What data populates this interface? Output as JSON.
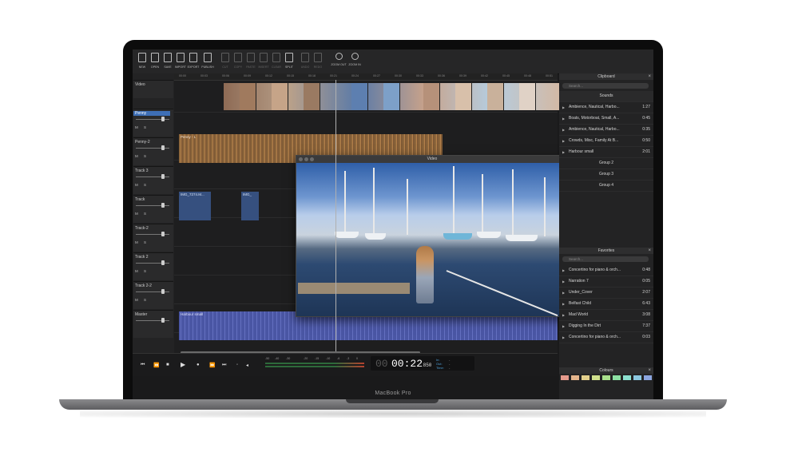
{
  "device": {
    "brand_label": "MacBook Pro"
  },
  "toolbar": {
    "buttons": [
      {
        "label": "NEW"
      },
      {
        "label": "OPEN"
      },
      {
        "label": "SAVE"
      },
      {
        "label": "IMPORT"
      },
      {
        "label": "EXPORT"
      },
      {
        "label": "PUBLISH"
      },
      {
        "label": "CUT"
      },
      {
        "label": "COPY"
      },
      {
        "label": "PASTE"
      },
      {
        "label": "INSERT"
      },
      {
        "label": "CLEAR"
      },
      {
        "label": "SPLIT"
      },
      {
        "label": "UNDO"
      },
      {
        "label": "REDO"
      },
      {
        "label": "ZOOM OUT"
      },
      {
        "label": "ZOOM IN"
      }
    ]
  },
  "ruler": {
    "ticks": [
      "00:00",
      "00:03",
      "00:06",
      "00:09",
      "00:12",
      "00:15",
      "00:18",
      "00:21",
      "00:24",
      "00:27",
      "00:30",
      "00:33",
      "00:36",
      "00:39",
      "00:42",
      "00:45",
      "00:48",
      "00:51"
    ]
  },
  "tracks": [
    {
      "name": "Video"
    },
    {
      "name": "Penny"
    },
    {
      "name": "Penny-2"
    },
    {
      "name": "Track 3"
    },
    {
      "name": "Track"
    },
    {
      "name": "Track-2"
    },
    {
      "name": "Track 2"
    },
    {
      "name": "Track 2-2"
    },
    {
      "name": "Master"
    }
  ],
  "track_buttons": "M S",
  "clips": {
    "penny": "Penny - L",
    "img1": "IMG_7274.M...",
    "img2": "IMG_",
    "harbour": "Harbour small"
  },
  "video_window": {
    "title": "Video"
  },
  "clipboard": {
    "title": "Clipboard",
    "search_placeholder": "Search...",
    "sounds_label": "Sounds",
    "items": [
      {
        "title": "Ambience, Nautical, Harbo...",
        "duration": "1:27"
      },
      {
        "title": "Boats, Motorboat, Small, A...",
        "duration": "0:45"
      },
      {
        "title": "Ambience, Nautical, Harbo...",
        "duration": "0:35"
      },
      {
        "title": "Crowds, Misc, Family At B...",
        "duration": "0:50"
      },
      {
        "title": "Harbour small",
        "duration": "2:01"
      }
    ],
    "groups": [
      "Group 2",
      "Group 3",
      "Group 4"
    ]
  },
  "favorites": {
    "title": "Favorites",
    "search_placeholder": "Search...",
    "items": [
      {
        "title": "Concertino for piano & orch...",
        "duration": "0:48"
      },
      {
        "title": "Narration 7",
        "duration": "0:05"
      },
      {
        "title": "Under_Cover",
        "duration": "2:07"
      },
      {
        "title": "Belfast Child",
        "duration": "6:43"
      },
      {
        "title": "Mad World",
        "duration": "3:08"
      },
      {
        "title": "Digging In the Dirt",
        "duration": "7:37"
      },
      {
        "title": "Concertino for piano & orch...",
        "duration": "0:03"
      }
    ]
  },
  "colours": {
    "title": "Colours",
    "swatches": [
      "#e59a8c",
      "#e5b58c",
      "#e3d08c",
      "#cfe08c",
      "#a9e08c",
      "#8ce0a2",
      "#8ce0cf",
      "#8cc8e0",
      "#8ca6e0"
    ]
  },
  "transport": {
    "meter_ticks": [
      "-50",
      "-40",
      "-30",
      "-20",
      "-15",
      "-10",
      "-6",
      "-3",
      "0"
    ],
    "clock_hours": "00",
    "clock_main": "00:22",
    "clock_ms": ".850",
    "in_label": "In:",
    "out_label": "Out:",
    "time_label": "Time:",
    "in_value": "-",
    "out_value": "-",
    "time_value": "-"
  },
  "colors": {
    "accent": "#3e6fb6",
    "penny_clip": "#c48b4f",
    "harbour_clip": "#5560b4",
    "green_clip": "#7cc094"
  }
}
